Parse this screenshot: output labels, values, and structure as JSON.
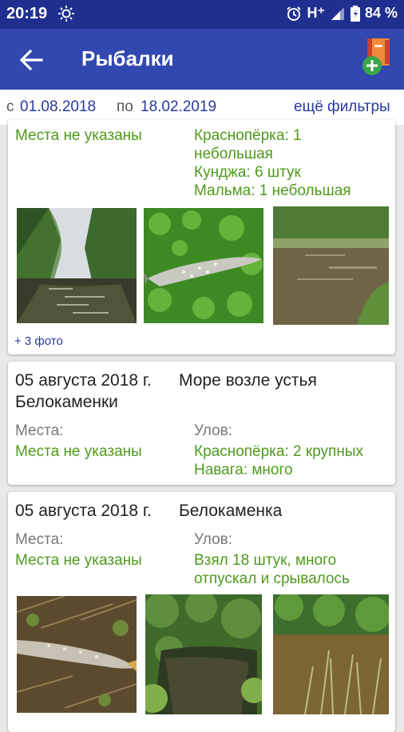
{
  "status_bar": {
    "time": "20:19",
    "icons": [
      "brightness-icon",
      "alarm-icon",
      "signal-icon",
      "battery-icon"
    ],
    "network": "H⁺",
    "battery": "84 %"
  },
  "app_bar": {
    "title": "Рыбалки",
    "back_icon": "arrow-back-icon",
    "action_icon": "add-book-icon"
  },
  "filters": {
    "from_label": "с",
    "from_date": "01.08.2018",
    "to_label": "по",
    "to_date": "18.02.2019",
    "more": "ещё фильтры"
  },
  "cards": [
    {
      "places_value": "Места не указаны",
      "catch_lines": [
        "Краснопёрка: 1",
        "небольшая",
        "Кунджа: 6 штук",
        "Мальма: 1 небольшая"
      ],
      "photos": [
        "river-photo",
        "fish-on-grass-photo",
        "river-bank-photo"
      ],
      "more_photos": "+ 3 фото"
    },
    {
      "date": "05 августа 2018 г.",
      "place": "Море возле устья",
      "place_line2": "Белокаменки",
      "places_label": "Места:",
      "places_value": "Места не указаны",
      "catch_label": "Улов:",
      "catch_lines": [
        "Краснопёрка: 2 крупных",
        "Навага: много"
      ]
    },
    {
      "date": "05 августа 2018 г.",
      "place": "Белокаменка",
      "places_label": "Места:",
      "places_value": "Места не указаны",
      "catch_label": "Улов:",
      "catch_lines": [
        "Взял 18 штук, много",
        "отпускал и срывалось"
      ],
      "photos": [
        "fish-on-ground-photo",
        "creek-photo",
        "reeds-river-photo"
      ]
    }
  ],
  "colors": {
    "status_bar": "#1f2f8f",
    "app_bar": "#3248b0",
    "accent_green": "#4f9a1d",
    "link_blue": "#2a3aa0"
  }
}
